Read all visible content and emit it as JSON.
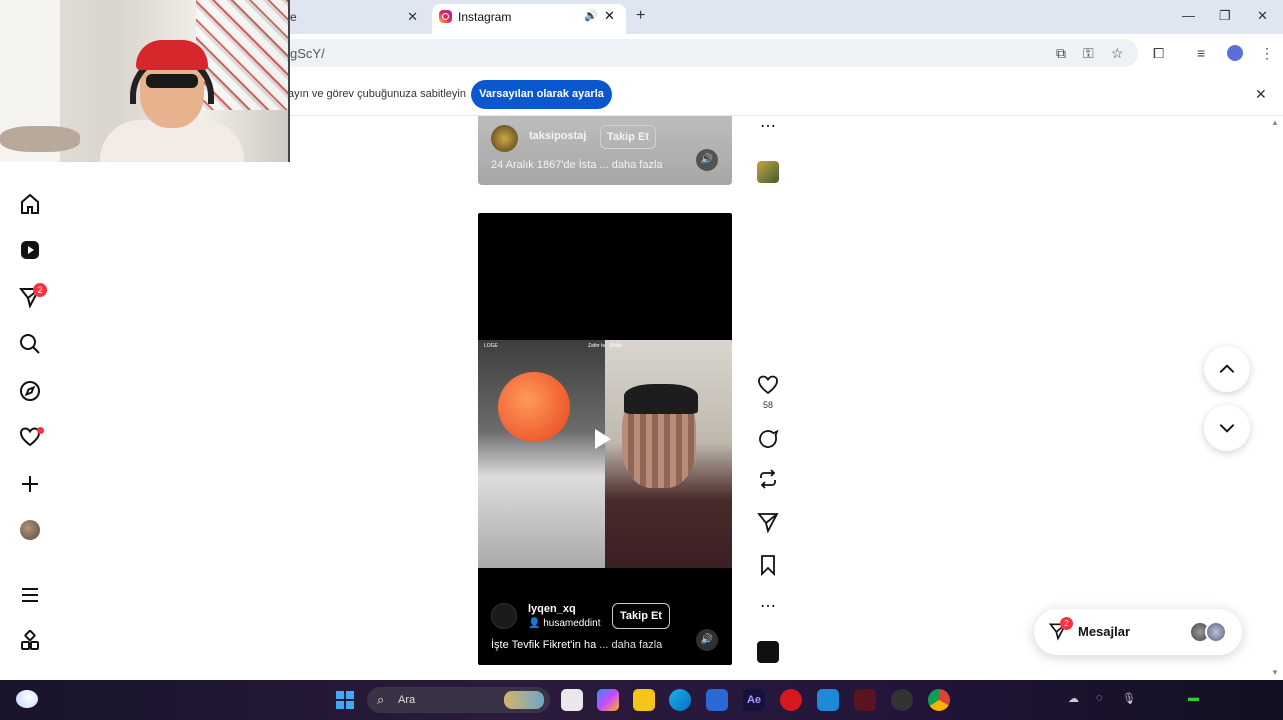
{
  "browser": {
    "prev_tab_title": "e",
    "active_tab_title": "Instagram",
    "url": "gScY/",
    "infobar_text": "ayın ve görev çubuğunuza sabitleyin",
    "infobar_button": "Varsayılan olarak ayarla"
  },
  "sidebar": {
    "messages_badge": "2"
  },
  "top_card": {
    "username": "taksipostaj",
    "follow_label": "Takip Et",
    "caption": "24 Aralık 1867'de İsta",
    "more": "... daha fazla"
  },
  "reel": {
    "username": "lyqen_xq",
    "collab": "husameddint",
    "follow_label": "Takip Et",
    "caption": "İşte Tevfik Fikret'in ha",
    "more": "... daha fazla",
    "like_count": "58",
    "video_tag_left": "LOGE",
    "video_tag_mid": "Zafer te",
    "video_tag_right": "Bitiler"
  },
  "messages": {
    "label": "Mesajlar",
    "badge": "2"
  },
  "taskbar": {
    "search_label": "Ara",
    "ae_label": "Ae"
  },
  "colors": {
    "accent": "#0b57d0",
    "badge": "#ff3040"
  }
}
